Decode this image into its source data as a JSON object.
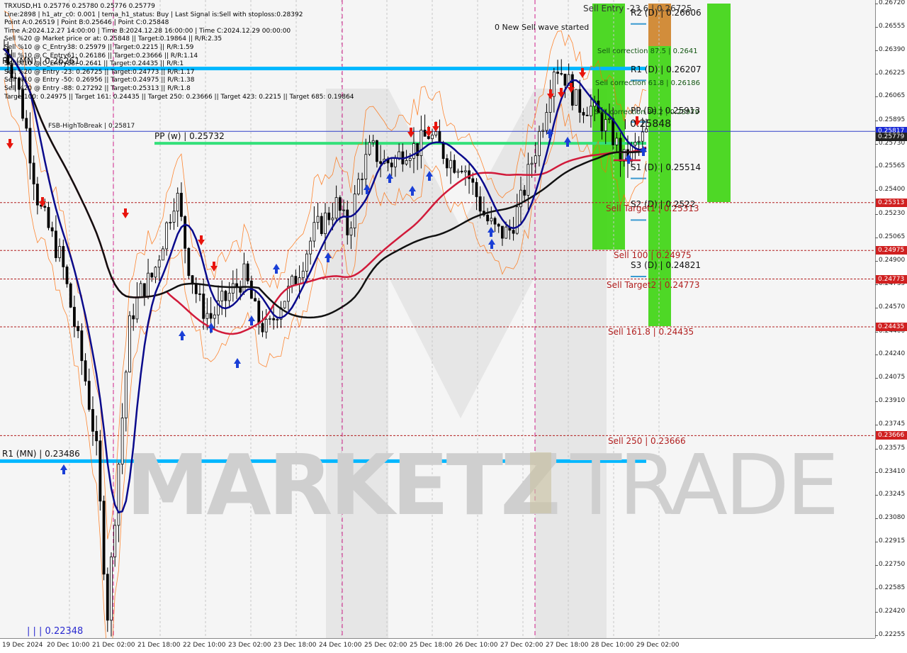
{
  "colors": {
    "bull": "#000000",
    "bear": "#000000",
    "ma_blue": "#0a0a8c",
    "ma_red": "#d11a3a",
    "ma_black": "#111111",
    "cyan": "#00b7ff",
    "green_pp": "#34e07a",
    "zone_green": "#44d61a",
    "zone_orange": "#d9893c",
    "sell_red": "#b11e1e",
    "orange_band": "#ff6a00",
    "tag_red": "#d02020",
    "tag_blue": "#1a2ad6",
    "tag_dark": "#222222",
    "arrow_red": "#e8140c",
    "arrow_blue": "#1a3fd6"
  },
  "info_panel": [
    "TRXUSD,H1  0.25776 0.25780 0.25776 0.25779",
    "Line:2898 | h1_atr_c0: 0.001 | tema_h1_status: Buy | Last Signal is:Sell with stoploss:0.28392",
    "Point A:0.26519 | Point B:0.25646 | Point C:0.25848",
    "Time A:2024.12.27 14:00:00 | Time B:2024.12.28 16:00:00 | Time C:2024.12.29 00:00:00",
    "Sell %20 @ Market price or at: 0.25848 || Target:0.19864 || R/R:2.35",
    "Sell %10 @ C_Entry38: 0.25979 || Target:0.2215 || R/R:1.59",
    "Sell %10 @ C_Entry61: 0.26186 || Target:0.23666 || R/R:1.14",
    "Sell %10 @ C_Entry88: 0.2641 || Target:0.24435 || R/R:1",
    "Sell %20 @ Entry -23: 0.26725 || Target:0.24773 || R/R:1.17",
    "Sell %10 @ Entry -50: 0.26956 || Target:0.24975 || R/R:1.38",
    "Sell %20 @ Entry -88: 0.27292 || Target:0.25313 || R/R:1.8",
    "Target100: 0.24975 || Target 161: 0.24435 || Target 250: 0.23666 || Target 423: 0.2215 || Target 685: 0.19864"
  ],
  "price_axis": {
    "min": 0.22255,
    "max": 0.2672,
    "ticks": [
      "0.26720",
      "0.26555",
      "0.26390",
      "0.26225",
      "0.26065",
      "0.25895",
      "0.25730",
      "0.25565",
      "0.25400",
      "0.25230",
      "0.25065",
      "0.24900",
      "0.24735",
      "0.24570",
      "0.24400",
      "0.24240",
      "0.24075",
      "0.23910",
      "0.23745",
      "0.23575",
      "0.23410",
      "0.23245",
      "0.23080",
      "0.22915",
      "0.22750",
      "0.22585",
      "0.22420",
      "0.22255"
    ]
  },
  "price_tags": [
    {
      "text": "0.25817",
      "price": 0.25817,
      "color": "tag_blue"
    },
    {
      "text": "0.25779",
      "price": 0.25779,
      "color": "tag_dark"
    },
    {
      "text": "0.25313",
      "price": 0.25313,
      "color": "tag_red"
    },
    {
      "text": "0.24975",
      "price": 0.24975,
      "color": "tag_red"
    },
    {
      "text": "0.24773",
      "price": 0.24773,
      "color": "tag_red"
    },
    {
      "text": "0.24435",
      "price": 0.24435,
      "color": "tag_red"
    },
    {
      "text": "0.23666",
      "price": 0.23666,
      "color": "tag_red"
    }
  ],
  "time_axis": [
    "19 Dec 2024",
    "20 Dec 10:00",
    "21 Dec 02:00",
    "21 Dec 18:00",
    "22 Dec 10:00",
    "23 Dec 02:00",
    "23 Dec 18:00",
    "24 Dec 10:00",
    "25 Dec 02:00",
    "25 Dec 18:00",
    "26 Dec 10:00",
    "27 Dec 02:00",
    "27 Dec 18:00",
    "28 Dec 10:00",
    "29 Dec 02:00"
  ],
  "levels": {
    "r2_mn": "R2 (MN) | 0.26261",
    "r1_mn": "R1 (MN) | 0.23486",
    "fsb": "FSB-HighToBreak | 0.25817",
    "pp_w": "PP (w) | 0.25732",
    "low_mark": "| | | 0.22348",
    "new_wave": "0 New Sell wave started",
    "sell_entry": "Sell Entry -23.6 | 0.26725",
    "r2_d": "R2 (D) | 0.26606",
    "sell_corr_875": "Sell correction 87.5 | 0.2641",
    "r1_d": "R1 (D) | 0.26207",
    "sell_corr_618": "Sell correction 61.8 | 0.26186",
    "sell_corr_382": "Sell correction 38.2 | 0.25979",
    "pp_d": "PP (D) | 0.25913",
    "c_price": "| 0.25848",
    "s1_d": "S1 (D) | 0.25514",
    "s2_d": "S2 (D) | 0.2522",
    "sell_target1": "Sell Target1 | 0.25313",
    "sell_100": "Sell 100 | 0.24975",
    "s3_d": "S3 (D) | 0.24821",
    "sell_target2": "Sell Target2 | 0.24773",
    "sell_1618": "Sell 161.8 | 0.24435",
    "sell_250": "Sell  250 | 0.23666"
  },
  "watermark": {
    "bold": "MARKETZ",
    "light": "TRADE"
  },
  "chart_data": {
    "type": "candlestick",
    "symbol": "TRXUSD",
    "timeframe": "H1",
    "last_ohlc": {
      "open": 0.25776,
      "high": 0.2578,
      "low": 0.25776,
      "close": 0.25779
    },
    "ylim": [
      0.22255,
      0.2672
    ],
    "x_ticks": [
      "19 Dec 2024",
      "20 Dec 10:00",
      "21 Dec 02:00",
      "21 Dec 18:00",
      "22 Dec 10:00",
      "23 Dec 02:00",
      "23 Dec 18:00",
      "24 Dec 10:00",
      "25 Dec 02:00",
      "25 Dec 18:00",
      "26 Dec 10:00",
      "27 Dec 02:00",
      "27 Dec 18:00",
      "28 Dec 10:00",
      "29 Dec 02:00"
    ],
    "close_path_approx": [
      0.264,
      0.262,
      0.258,
      0.253,
      0.251,
      0.249,
      0.245,
      0.241,
      0.236,
      0.224,
      0.235,
      0.245,
      0.247,
      0.248,
      0.251,
      0.254,
      0.249,
      0.246,
      0.245,
      0.246,
      0.247,
      0.248,
      0.245,
      0.244,
      0.246,
      0.247,
      0.249,
      0.251,
      0.252,
      0.253,
      0.251,
      0.255,
      0.257,
      0.256,
      0.256,
      0.257,
      0.257,
      0.258,
      0.257,
      0.256,
      0.256,
      0.254,
      0.252,
      0.251,
      0.251,
      0.253,
      0.256,
      0.259,
      0.263,
      0.262,
      0.26,
      0.26,
      0.259,
      0.258,
      0.256,
      0.257,
      0.258
    ],
    "horizontal_levels": [
      {
        "name": "R2 (MN)",
        "value": 0.26261
      },
      {
        "name": "R1 (MN)",
        "value": 0.23486
      },
      {
        "name": "FSB-HighToBreak",
        "value": 0.25817
      },
      {
        "name": "PP (w)",
        "value": 0.25732
      },
      {
        "name": "Sell Entry -23.6",
        "value": 0.26725
      },
      {
        "name": "R2 (D)",
        "value": 0.26606
      },
      {
        "name": "Sell correction 87.5",
        "value": 0.2641
      },
      {
        "name": "R1 (D)",
        "value": 0.26207
      },
      {
        "name": "Sell correction 61.8",
        "value": 0.26186
      },
      {
        "name": "Sell correction 38.2",
        "value": 0.25979
      },
      {
        "name": "PP (D)",
        "value": 0.25913
      },
      {
        "name": "S1 (D)",
        "value": 0.25514
      },
      {
        "name": "Sell Target1",
        "value": 0.25313
      },
      {
        "name": "S2 (D)",
        "value": 0.2522
      },
      {
        "name": "Sell 100",
        "value": 0.24975
      },
      {
        "name": "S3 (D)",
        "value": 0.24821
      },
      {
        "name": "Sell Target2",
        "value": 0.24773
      },
      {
        "name": "Sell 161.8",
        "value": 0.24435
      },
      {
        "name": "Sell 250",
        "value": 0.23666
      }
    ]
  }
}
